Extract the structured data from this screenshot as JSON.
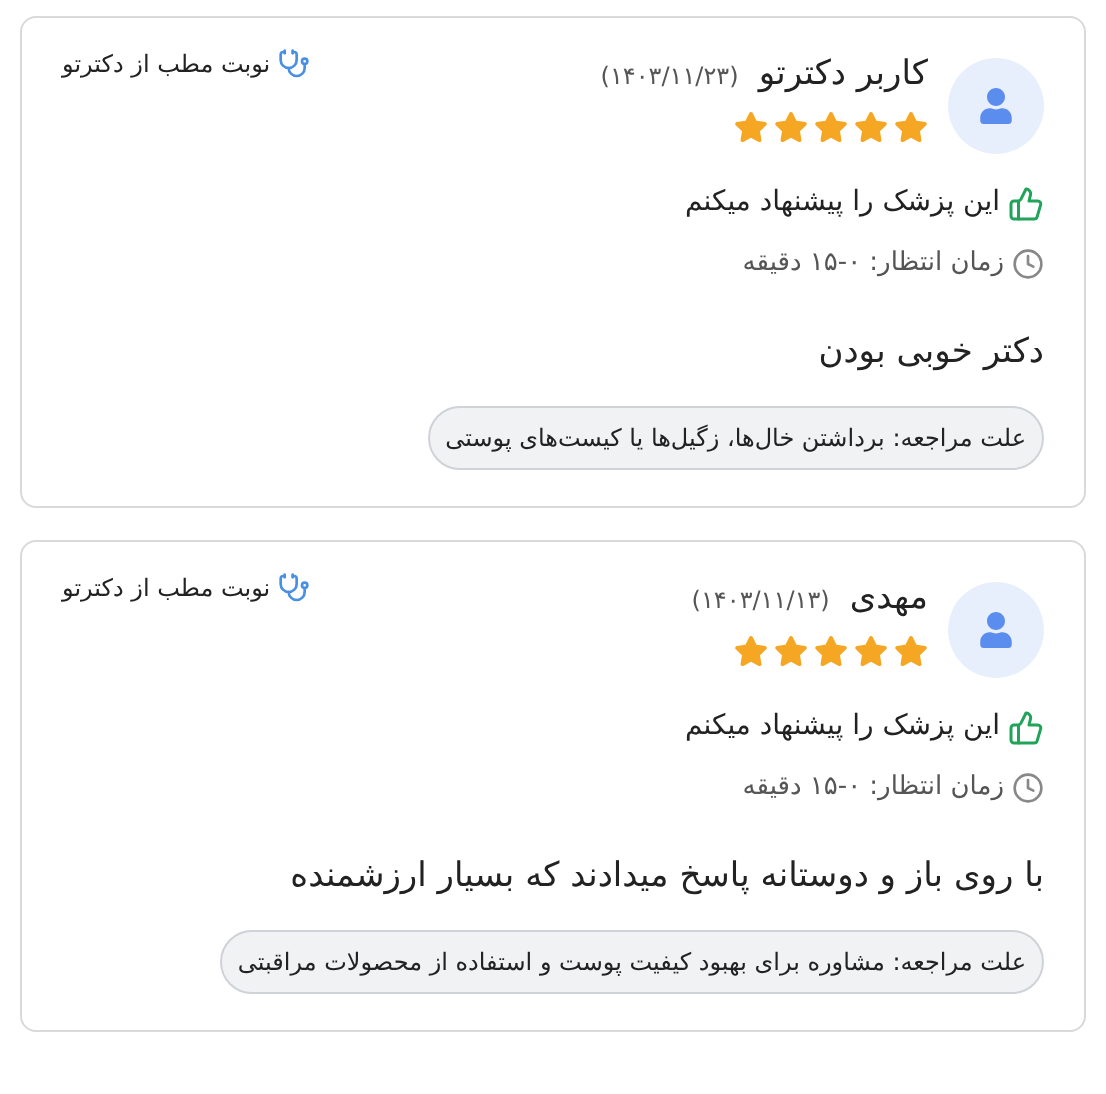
{
  "reviews": [
    {
      "name": "کاربر دکترتو",
      "date": "(۱۴۰۳/۱۱/۲۳)",
      "stars": 5,
      "recommended": true,
      "recommend_text": "این پزشک را پیشنهاد میکنم",
      "wait_time": "زمان انتظار: ۰-۱۵ دقیقه",
      "comment": "دکتر خوبی بودن",
      "reason": "علت مراجعه: برداشتن خال‌ها، زگیل‌ها یا کیست‌های پوستی",
      "source": "نوبت مطب از دکترتو"
    },
    {
      "name": "مهدی",
      "date": "(۱۴۰۳/۱۱/۱۳)",
      "stars": 5,
      "recommended": true,
      "recommend_text": "این پزشک را پیشنهاد میکنم",
      "wait_time": "زمان انتظار: ۰-۱۵ دقیقه",
      "comment": "با روی باز و دوستانه پاسخ میدادند که بسیار ارزشمنده",
      "reason": "علت مراجعه: مشاوره برای بهبود کیفیت پوست و استفاده از محصولات مراقبتی",
      "source": "نوبت مطب از دکترتو"
    }
  ]
}
